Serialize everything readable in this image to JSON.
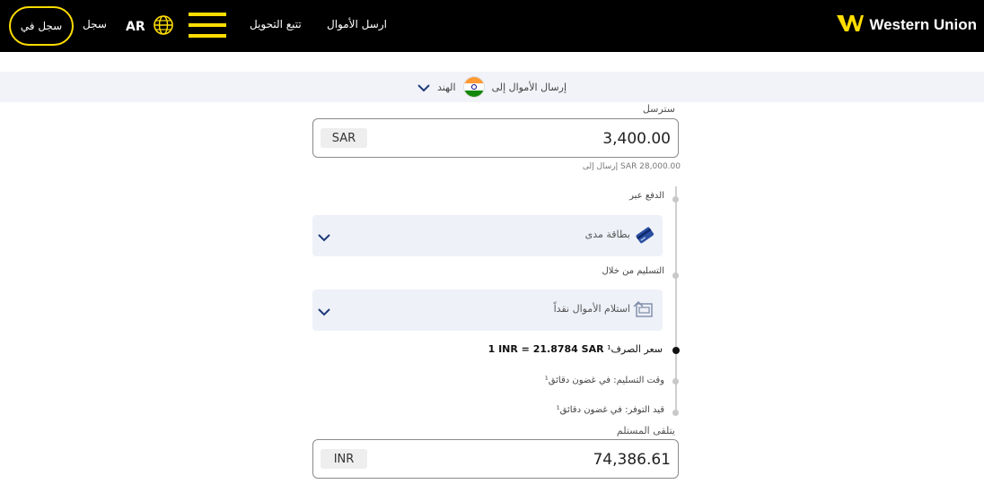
{
  "header": {
    "brand": "Western Union",
    "nav": {
      "send_money": "ارسل الأموال",
      "track_transfer": "تتبع التحويل"
    },
    "language": "AR",
    "register": "سجل",
    "sign_in": "سجل في"
  },
  "country_bar": {
    "text": "إرسال الأموال إلى",
    "country": "الهند"
  },
  "send": {
    "label": "سترسل",
    "currency": "SAR",
    "amount": "3,400.00",
    "limit_note": "إرسال إلى SAR 28,000.00"
  },
  "pay_by": {
    "label": "الدفع عبر",
    "value": "بطاقة مدى"
  },
  "delivery": {
    "label": "التسليم من خلال",
    "value": "استلام الأموال نقداً"
  },
  "rate": {
    "label": "سعر الصرف¹",
    "value": "1 INR = 21.8784 SAR"
  },
  "delivery_time": {
    "label": "وقت التسليم: في غضون دقائق¹"
  },
  "availability": {
    "label": "قيد التوفر: في غضون دقائق¹"
  },
  "receive": {
    "label": "يتلقى المستلم",
    "currency": "INR",
    "amount": "74,386.61"
  },
  "colors": {
    "brand_yellow": "#ffdd00",
    "header_bg": "#000000",
    "panel_bg": "#eef1f8"
  },
  "icons": [
    "globe-icon",
    "hamburger-menu-icon",
    "wu-logo-icon",
    "india-flag-icon",
    "chevron-down-icon",
    "card-icon",
    "cash-pickup-icon"
  ]
}
